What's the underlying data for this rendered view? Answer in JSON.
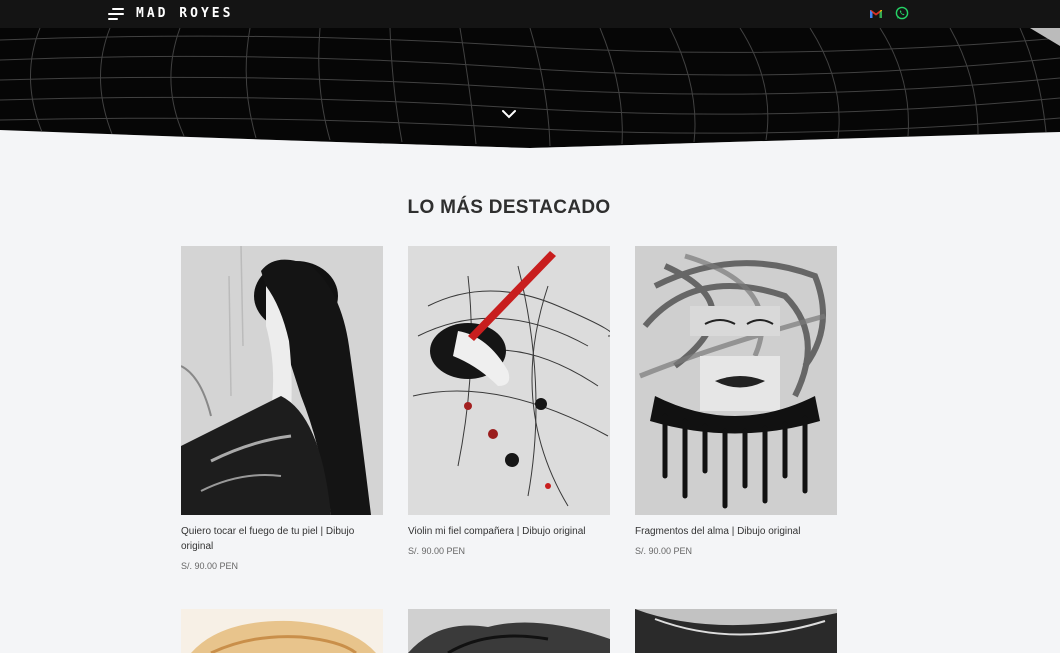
{
  "header": {
    "logo_text": "MAD ROYES",
    "menu_icon": "hamburger-icon",
    "contact_icons": [
      "gmail-icon",
      "whatsapp-icon"
    ]
  },
  "hero": {
    "scroll_icon": "chevron-down-icon"
  },
  "section": {
    "title": "LO MÁS DESTACADO"
  },
  "products": [
    {
      "title": "Quiero tocar el fuego de tu piel | Dibujo original",
      "price": "S/. 90.00 PEN"
    },
    {
      "title": "Violin mi fiel compañera | Dibujo original",
      "price": "S/. 90.00 PEN"
    },
    {
      "title": "Fragmentos del alma | Dibujo original",
      "price": "S/. 90.00 PEN"
    }
  ],
  "colors": {
    "background": "#f4f5f7",
    "header": "#141414",
    "accent_red": "#c81e1e"
  }
}
